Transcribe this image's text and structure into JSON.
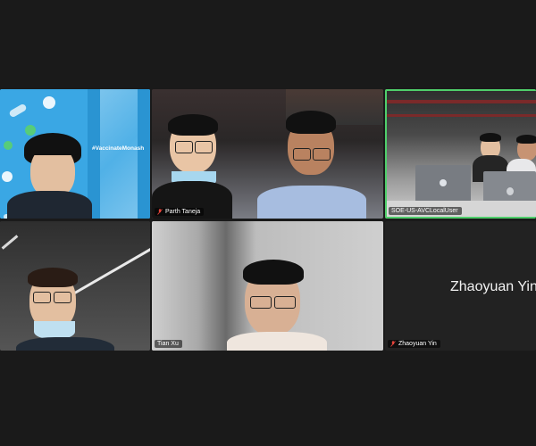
{
  "tiles": [
    {
      "name": "",
      "banner_text": "#VaccinateMonash",
      "muted": false
    },
    {
      "name": "Parth Taneja",
      "muted": true
    },
    {
      "name": "SOE-US-AVCLocalUser",
      "muted": false,
      "active_speaker": true
    },
    {
      "name": "",
      "muted": false
    },
    {
      "name": "Tian Xu",
      "muted": false
    },
    {
      "name": "Zhaoyuan Yin",
      "display_text": "Zhaoyuan Yin",
      "muted": true,
      "video_off": true
    }
  ],
  "colors": {
    "background": "#1a1a1a",
    "active_border": "#4fcf6b",
    "muted_icon": "#e5443b",
    "banner_blue": "#2ea1e0"
  }
}
